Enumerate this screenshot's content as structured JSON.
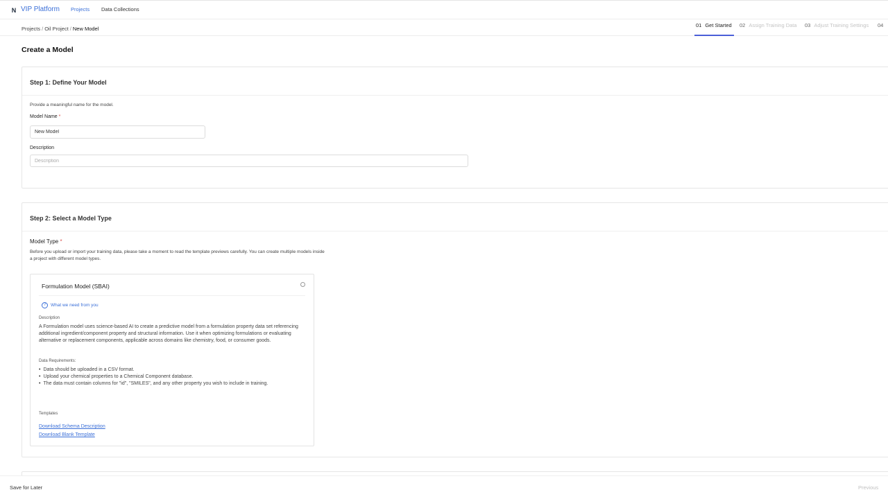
{
  "header": {
    "logo_letter": "N",
    "app_name": "VIP Platform",
    "nav": {
      "projects": "Projects",
      "data_collections": "Data Collections"
    }
  },
  "breadcrumb": {
    "items": [
      "Projects",
      "Oil Project"
    ],
    "separator": "/",
    "current": "New Model"
  },
  "wizard_steps": [
    {
      "num": "01",
      "label": "Get Started"
    },
    {
      "num": "02",
      "label": "Assign Training Data"
    },
    {
      "num": "03",
      "label": "Adjust Training Settings"
    },
    {
      "num": "04",
      "label": ""
    }
  ],
  "page": {
    "title": "Create a Model"
  },
  "step1": {
    "title": "Step 1: Define Your Model",
    "helper": "Provide a meaningful name for the model.",
    "model_name_label": "Model Name",
    "required_mark": "*",
    "model_name_value": "New Model",
    "description_label": "Description",
    "description_placeholder": "Description"
  },
  "step2": {
    "title": "Step 2: Select a Model Type",
    "model_type_label": "Model Type",
    "required_mark": "*",
    "intro": "Before you upload or import your training data, please take a moment to read the template previews carefully. You can create multiple models inside a project with different model types.",
    "model_card": {
      "title": "Formulation Model (SBAI)",
      "help_icon_glyph": "?",
      "need_link": "What we need from you",
      "description_label": "Description",
      "description": "A Formulation model uses science-based AI to create a predictive model from a formulation property data set referencing additional ingredient/component property and structural information. Use it when optimizing formulations or evaluating alternative or replacement components, applicable across domains like chemistry, food, or consumer goods.",
      "requirements_label": "Data Requirements:",
      "requirements": [
        "Data should be uploaded in a CSV format.",
        "Upload your chemical properties to a Chemical Component database.",
        "The data must contain columns for \"id\", \"SMILES\", and any other property you wish to include in training."
      ],
      "templates_label": "Templates",
      "link_schema": "Download Schema Description",
      "link_blank": "Download Blank Template"
    }
  },
  "footer": {
    "save_later": "Save for Later",
    "previous": "Previous"
  },
  "colors": {
    "accent": "#3a6fd8",
    "step_underline": "#4a5ed8",
    "required": "#d9534f"
  }
}
